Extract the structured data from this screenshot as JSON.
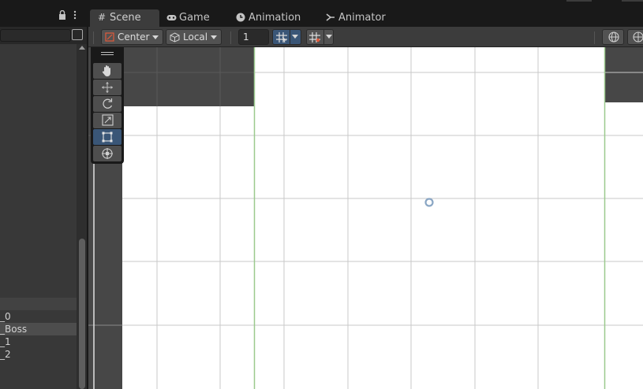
{
  "hierarchy": {
    "items": [
      {
        "label": "_0",
        "selected": false
      },
      {
        "label": "_Boss",
        "selected": true
      },
      {
        "label": "_1",
        "selected": false
      },
      {
        "label": "_2",
        "selected": false
      }
    ]
  },
  "tabs": [
    {
      "label": "Scene",
      "icon": "grid-icon",
      "active": true
    },
    {
      "label": "Game",
      "icon": "gamepad-icon",
      "active": false
    },
    {
      "label": "Animation",
      "icon": "clock-icon",
      "active": false
    },
    {
      "label": "Animator",
      "icon": "animator-icon",
      "active": false
    }
  ],
  "toolbar": {
    "pivot_label": "Center",
    "space_label": "Local",
    "increment_value": "1"
  },
  "tools": [
    {
      "name": "hand-tool",
      "active": false
    },
    {
      "name": "move-tool",
      "active": false
    },
    {
      "name": "rotate-tool",
      "active": false
    },
    {
      "name": "scale-tool",
      "active": false
    },
    {
      "name": "rect-tool",
      "active": true
    },
    {
      "name": "transform-tool",
      "active": false
    }
  ],
  "colors": {
    "active_tab": "#3c3c3c",
    "active_tool": "#3a5677",
    "camera_bounds": "#9bc98e",
    "scene_background": "#ffffff"
  }
}
